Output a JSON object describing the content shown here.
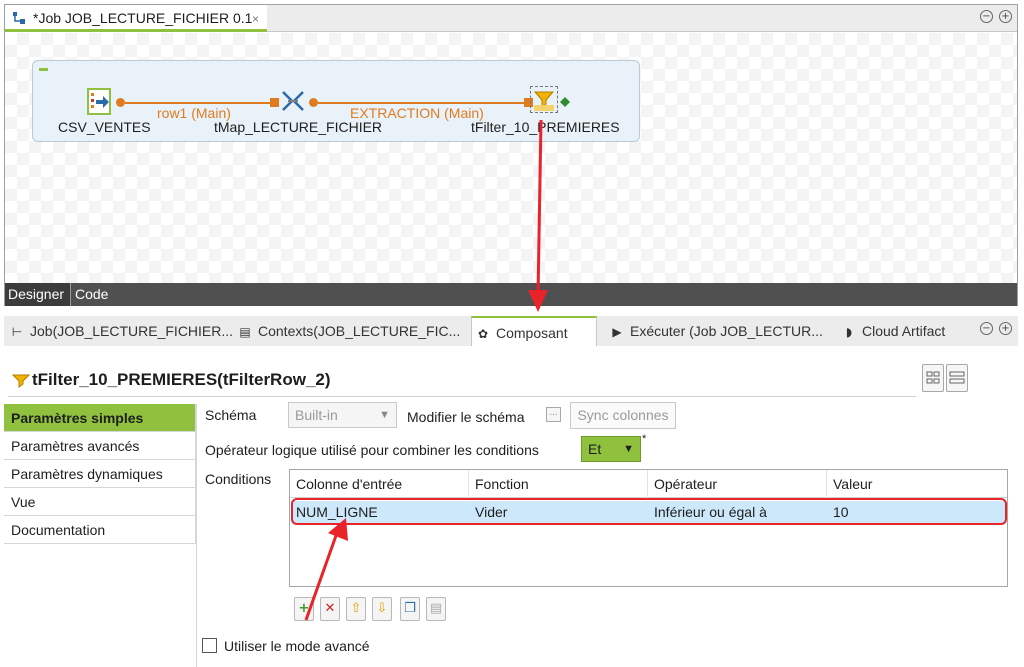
{
  "editor": {
    "tab_title": "*Job JOB_LECTURE_FICHIER 0.1",
    "close_glyph": "×",
    "minimize_glyph": "−",
    "maximize_glyph": "+",
    "bottom_tabs": {
      "designer": "Designer",
      "code": "Code"
    },
    "components": {
      "input": "CSV_VENTES",
      "map": "tMap_LECTURE_FICHIER",
      "filter": "tFilter_10_PREMIERES"
    },
    "links": {
      "first": "row1 (Main)",
      "second": "EXTRACTION (Main)"
    }
  },
  "panel": {
    "tabs": {
      "job": "Job(JOB_LECTURE_FICHIER...",
      "contexts": "Contexts(JOB_LECTURE_FIC...",
      "composant": "Composant",
      "executer": "Exécuter (Job JOB_LECTUR...",
      "cloud": "Cloud Artifact"
    },
    "title": "tFilter_10_PREMIERES(tFilterRow_2)",
    "nav": {
      "simple": "Paramètres simples",
      "advanced": "Paramètres avancés",
      "dynamic": "Paramètres dynamiques",
      "view": "Vue",
      "doc": "Documentation"
    },
    "form": {
      "schema_label": "Schéma",
      "schema_value": "Built-in",
      "edit_schema_label": "Modifier le schéma",
      "edit_schema_glyph": "...",
      "sync_label": "Sync colonnes",
      "logical_op_label": "Opérateur logique utilisé pour combiner les conditions",
      "logical_op_value": "Et",
      "required_mark": "*",
      "conditions_label": "Conditions",
      "advanced_mode_label": "Utiliser le mode avancé"
    },
    "conditions": {
      "headers": {
        "col": "Colonne d'entrée",
        "fn": "Fonction",
        "op": "Opérateur",
        "val": "Valeur"
      },
      "rows": [
        {
          "col": "NUM_LIGNE",
          "fn": "Vider",
          "op": "Inférieur ou égal à",
          "val": "10"
        }
      ]
    }
  },
  "colors": {
    "accent_green": "#8fc13e",
    "link_orange": "#e07b1f",
    "annotation_red": "#e8232a",
    "row_selected": "#cde8fa"
  }
}
